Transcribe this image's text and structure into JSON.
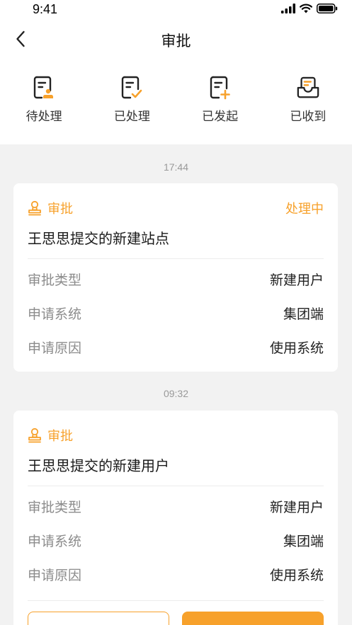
{
  "status_bar": {
    "time": "9:41"
  },
  "header": {
    "title": "审批"
  },
  "tabs": [
    {
      "label": "待处理",
      "icon": "pending-doc-icon"
    },
    {
      "label": "已处理",
      "icon": "processed-doc-icon"
    },
    {
      "label": "已发起",
      "icon": "initiated-doc-icon"
    },
    {
      "label": "已收到",
      "icon": "inbox-icon"
    }
  ],
  "groups": [
    {
      "time": "17:44",
      "card": {
        "type_label": "审批",
        "status": "处理中",
        "title": "王思思提交的新建站点",
        "rows": [
          {
            "label": "审批类型",
            "value": "新建用户"
          },
          {
            "label": "申请系统",
            "value": "集团端"
          },
          {
            "label": "申请原因",
            "value": "使用系统"
          }
        ]
      }
    },
    {
      "time": "09:32",
      "card": {
        "type_label": "审批",
        "title": "王思思提交的新建用户",
        "rows": [
          {
            "label": "审批类型",
            "value": "新建用户"
          },
          {
            "label": "申请系统",
            "value": "集团端"
          },
          {
            "label": "申请原因",
            "value": "使用系统"
          }
        ]
      }
    }
  ],
  "colors": {
    "accent": "#f7a12b",
    "background": "#f2f2f2",
    "label_gray": "#8c8c8c"
  }
}
